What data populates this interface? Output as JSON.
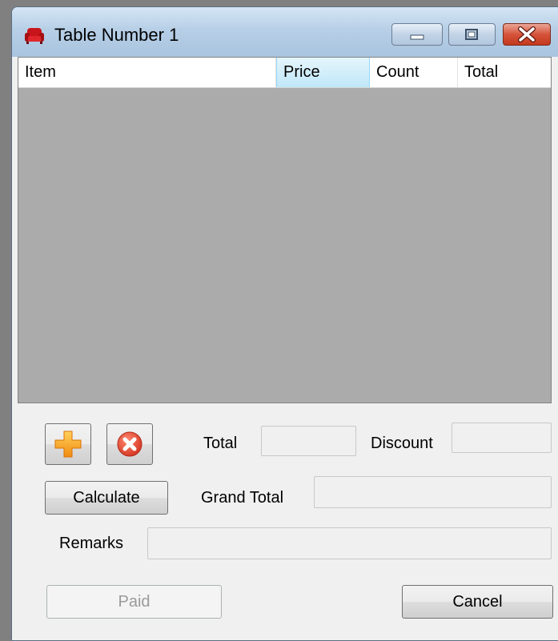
{
  "window": {
    "title": "Table Number 1",
    "icon": "red-armchair-icon",
    "controls": {
      "minimize": "minimize-icon",
      "maximize": "maximize-icon",
      "close": "close-icon"
    }
  },
  "list": {
    "columns": [
      "Item",
      "Price",
      "Count",
      "Total"
    ],
    "selected_column": "Price"
  },
  "toolbar": {
    "add_icon": "plus-icon",
    "remove_icon": "remove-circle-icon"
  },
  "form": {
    "total_label": "Total",
    "total_value": "",
    "discount_label": "Discount",
    "discount_value": "",
    "calculate_label": "Calculate",
    "grand_total_label": "Grand Total",
    "grand_total_value": "",
    "remarks_label": "Remarks",
    "remarks_value": "",
    "paid_label": "Paid",
    "cancel_label": "Cancel"
  },
  "colors": {
    "accent_orange": "#f7941d",
    "remove_red": "#e0442c",
    "list_background": "#ababab"
  }
}
